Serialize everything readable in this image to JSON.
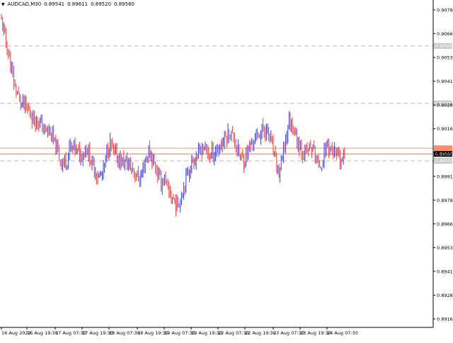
{
  "header": {
    "symbol": "AUDCAD,M30",
    "open": "0.89541",
    "high": "0.89611",
    "low": "0.89520",
    "close": "0.89560"
  },
  "colors": {
    "background": "#ffffff",
    "axis": "#000000",
    "level_line": "#b8b8b8",
    "bull": "#2f3cff",
    "bear": "#ff3b2f",
    "current_price_line": "#ff8c6b",
    "current_price_label_bg": "#000000",
    "current_price_label_fg": "#ffffff",
    "level_label_bg": "#c8c8c8"
  },
  "chart_data": {
    "type": "candlestick",
    "ylim": [
      0.8805,
      0.909
    ],
    "y_ticks": [
      "0.90780",
      "0.90660",
      "0.90535",
      "0.90410",
      "0.90285",
      "0.90160",
      "0.90035",
      "0.89910",
      "0.89785",
      "0.89660",
      "0.89535",
      "0.89410",
      "0.89285",
      "0.89160"
    ],
    "x_ticks": [
      "16 Aug 2022",
      "16 Aug 19:30",
      "17 Aug 07:30",
      "17 Aug 19:30",
      "18 Aug 07:30",
      "18 Aug 19:30",
      "19 Aug 07:30",
      "19 Aug 19:30",
      "22 Aug 07:30",
      "22 Aug 19:30",
      "23 Aug 07:30",
      "23 Aug 19:30",
      "24 Aug 07:30"
    ],
    "levels": [
      {
        "value": "0.90500",
        "y": 0.905
      },
      {
        "value": "0.90000",
        "y": 0.9
      },
      {
        "value": "0.89500",
        "y": 0.895
      }
    ],
    "current_price": {
      "label": "0.89560",
      "y": 0.8956
    },
    "price_line_2": {
      "y": 0.8961
    },
    "path": [
      [
        0,
        0.9075
      ],
      [
        3,
        0.907
      ],
      [
        8,
        0.9055
      ],
      [
        14,
        0.9035
      ],
      [
        22,
        0.9012
      ],
      [
        30,
        0.9
      ],
      [
        38,
        0.8995
      ],
      [
        46,
        0.8988
      ],
      [
        54,
        0.8985
      ],
      [
        62,
        0.8978
      ],
      [
        68,
        0.8975
      ],
      [
        74,
        0.897
      ],
      [
        80,
        0.896
      ],
      [
        86,
        0.895
      ],
      [
        90,
        0.8948
      ],
      [
        94,
        0.895
      ],
      [
        98,
        0.896
      ],
      [
        104,
        0.8962
      ],
      [
        112,
        0.8955
      ],
      [
        118,
        0.8958
      ],
      [
        122,
        0.8962
      ],
      [
        128,
        0.895
      ],
      [
        134,
        0.8942
      ],
      [
        140,
        0.8935
      ],
      [
        146,
        0.894
      ],
      [
        152,
        0.896
      ],
      [
        156,
        0.8965
      ],
      [
        162,
        0.8955
      ],
      [
        170,
        0.895
      ],
      [
        180,
        0.8948
      ],
      [
        190,
        0.894
      ],
      [
        198,
        0.8933
      ],
      [
        204,
        0.8948
      ],
      [
        210,
        0.8958
      ],
      [
        216,
        0.895
      ],
      [
        222,
        0.894
      ],
      [
        228,
        0.893
      ],
      [
        232,
        0.8935
      ],
      [
        238,
        0.8922
      ],
      [
        244,
        0.8918
      ],
      [
        250,
        0.891
      ],
      [
        256,
        0.892
      ],
      [
        264,
        0.8938
      ],
      [
        272,
        0.895
      ],
      [
        280,
        0.8955
      ],
      [
        288,
        0.8963
      ],
      [
        296,
        0.8955
      ],
      [
        304,
        0.8958
      ],
      [
        310,
        0.8962
      ],
      [
        318,
        0.897
      ],
      [
        324,
        0.8975
      ],
      [
        332,
        0.8968
      ],
      [
        338,
        0.8955
      ],
      [
        344,
        0.895
      ],
      [
        352,
        0.896
      ],
      [
        360,
        0.897
      ],
      [
        368,
        0.8975
      ],
      [
        376,
        0.8978
      ],
      [
        382,
        0.8968
      ],
      [
        388,
        0.8952
      ],
      [
        394,
        0.8938
      ],
      [
        398,
        0.895
      ],
      [
        404,
        0.8968
      ],
      [
        408,
        0.8985
      ],
      [
        414,
        0.898
      ],
      [
        420,
        0.8968
      ],
      [
        426,
        0.896
      ],
      [
        432,
        0.8955
      ],
      [
        438,
        0.8962
      ],
      [
        444,
        0.8958
      ],
      [
        450,
        0.8945
      ],
      [
        456,
        0.895
      ],
      [
        462,
        0.8965
      ],
      [
        468,
        0.896
      ],
      [
        474,
        0.8955
      ],
      [
        480,
        0.895
      ],
      [
        486,
        0.8953
      ],
      [
        488,
        0.8955
      ]
    ],
    "seed": 11
  }
}
